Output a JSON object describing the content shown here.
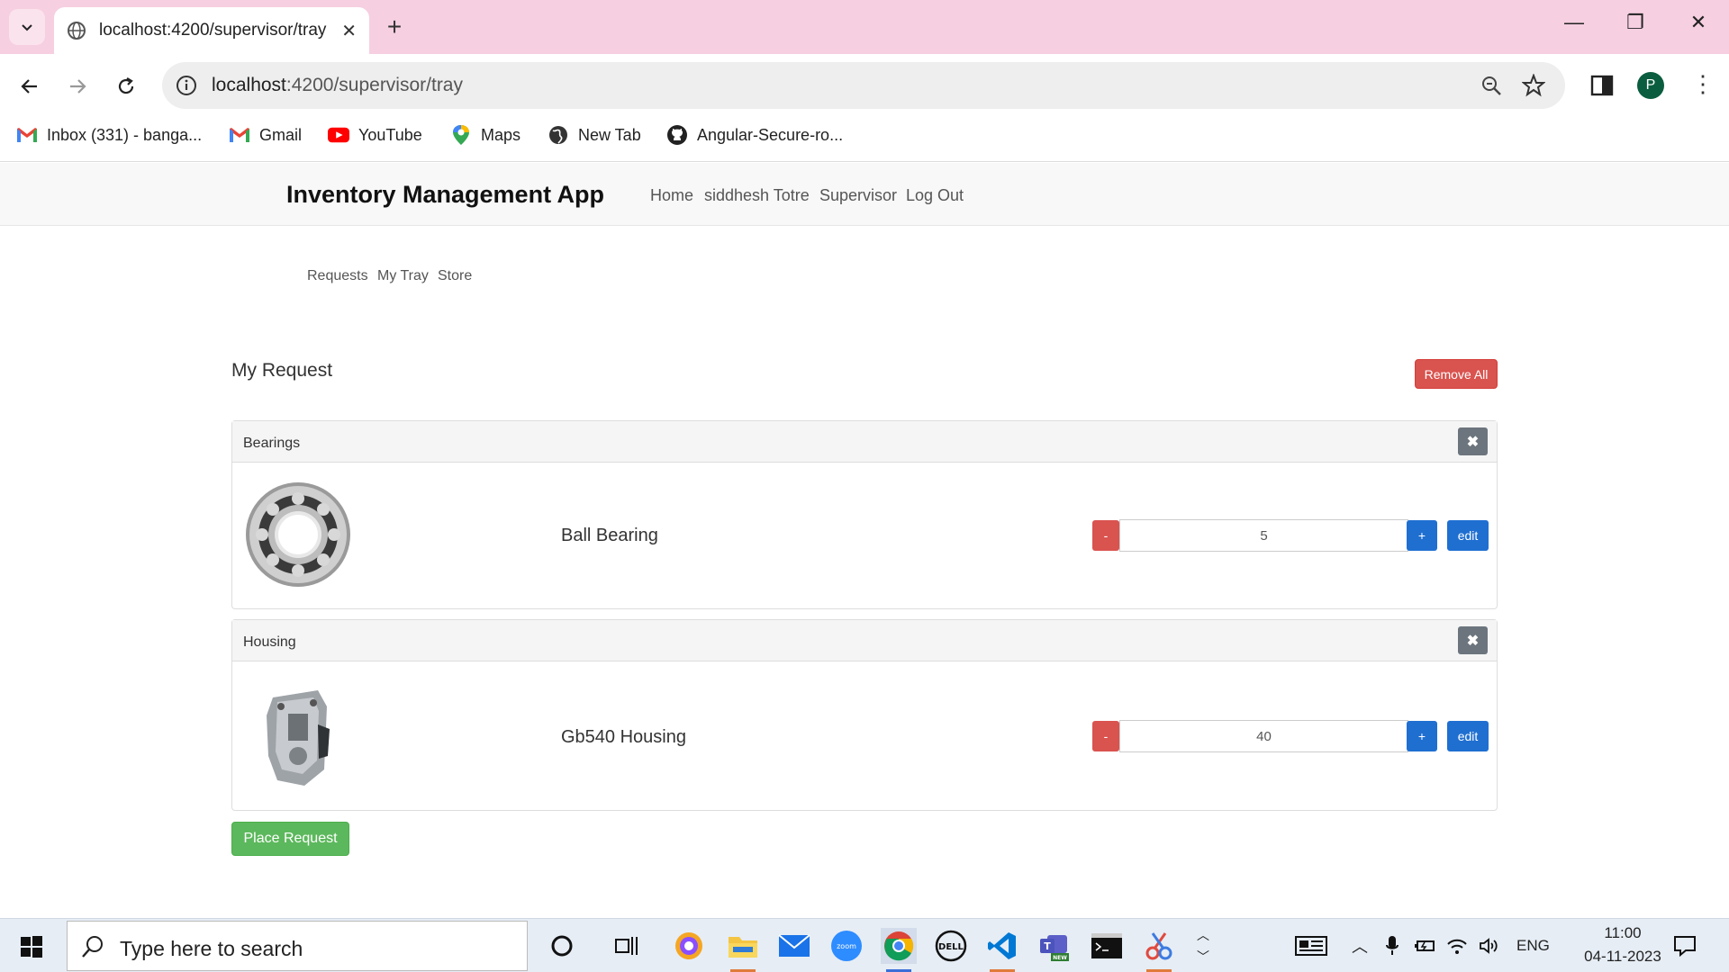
{
  "browser": {
    "tab_title": "localhost:4200/supervisor/tray",
    "url_host": "localhost",
    "url_path": ":4200/supervisor/tray",
    "avatar_letter": "P",
    "bookmarks": [
      {
        "label": "Inbox (331) - banga...",
        "icon": "gmail-icon"
      },
      {
        "label": "Gmail",
        "icon": "gmail-icon"
      },
      {
        "label": "YouTube",
        "icon": "youtube-icon"
      },
      {
        "label": "Maps",
        "icon": "maps-icon"
      },
      {
        "label": "New Tab",
        "icon": "globe-icon"
      },
      {
        "label": "Angular-Secure-ro...",
        "icon": "github-icon"
      }
    ]
  },
  "app": {
    "brand": "Inventory Management App",
    "nav": [
      "Home",
      "siddhesh Totre",
      "Supervisor",
      "Log Out"
    ],
    "subnav": [
      "Requests",
      "My Tray",
      "Store"
    ],
    "title": "My Request",
    "remove_all": "Remove All",
    "close_glyph": "✖",
    "minus": "-",
    "plus": "+",
    "edit": "edit",
    "place_request": "Place Request",
    "items": [
      {
        "category": "Bearings",
        "name": "Ball Bearing",
        "quantity": "5"
      },
      {
        "category": "Housing",
        "name": "Gb540 Housing",
        "quantity": "40"
      }
    ]
  },
  "taskbar": {
    "search_placeholder": "Type here to search",
    "language": "ENG",
    "time": "11:00",
    "date": "04-11-2023"
  },
  "colors": {
    "tabstrip": "#f6cfe0",
    "danger": "#d9534f",
    "primary": "#1f6fd1",
    "success": "#5cb85c"
  }
}
